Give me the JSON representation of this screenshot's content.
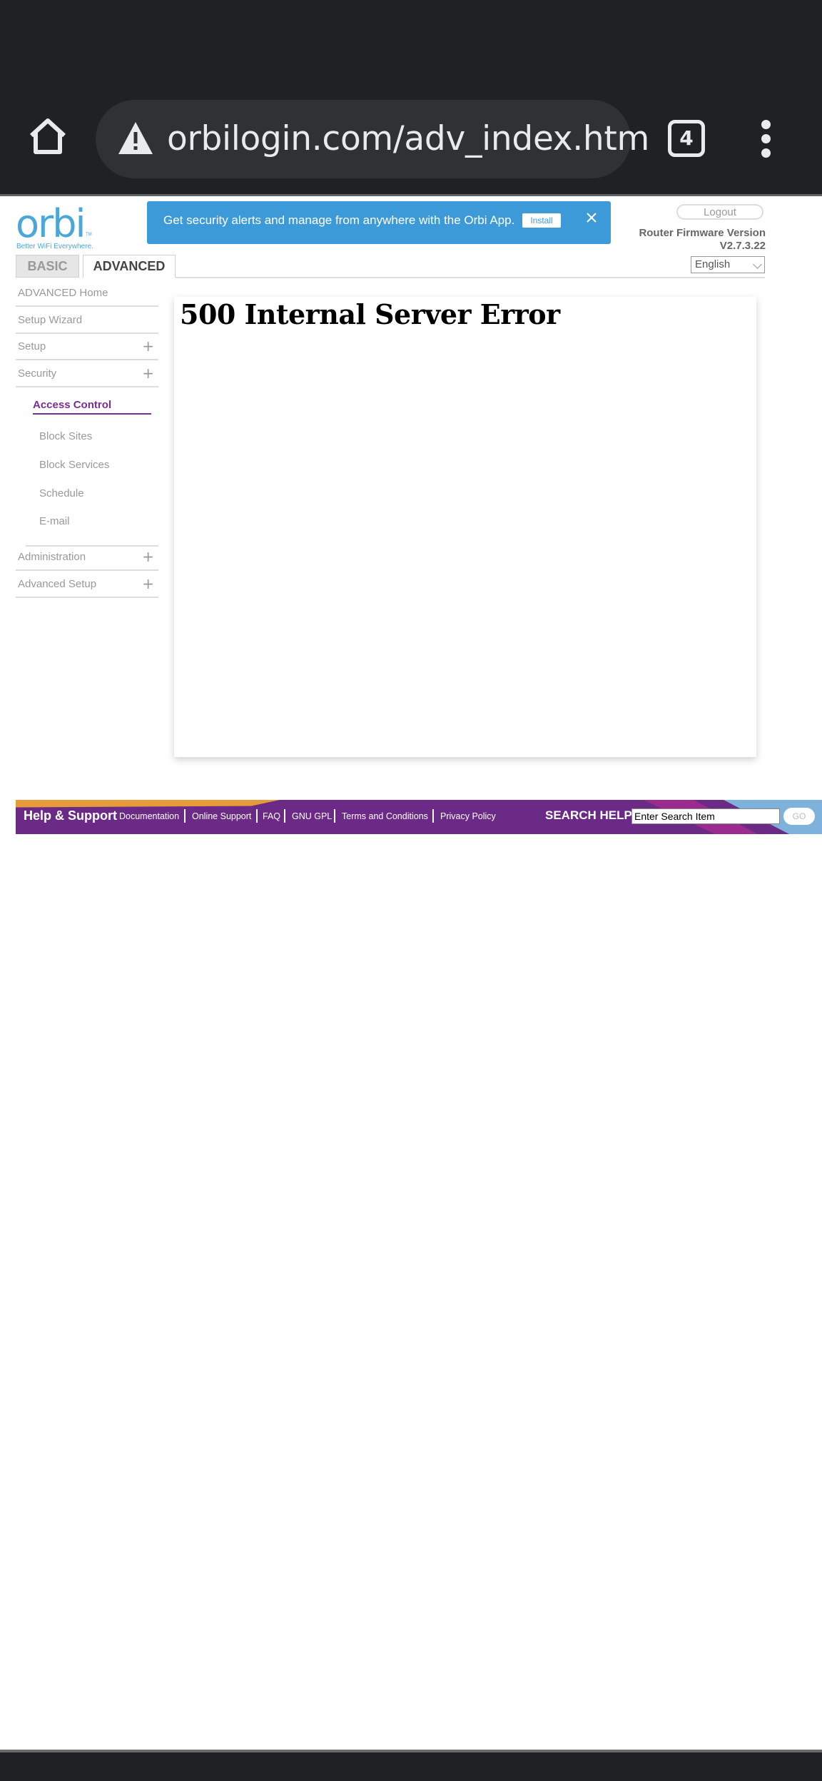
{
  "browser": {
    "url": "orbilogin.com/adv_index.htm",
    "tab_count": "4",
    "icons": [
      "home-icon",
      "warning-icon",
      "tabs-icon",
      "more-vert-icon"
    ]
  },
  "header": {
    "logo": "orbi",
    "logo_tm": "TM",
    "tagline": "Better WiFi Everywhere.",
    "banner_text": "Get security alerts and manage from anywhere with the Orbi App.",
    "install_label": "Install",
    "logout_label": "Logout",
    "firmware_label": "Router Firmware Version",
    "firmware_version": "V2.7.3.22",
    "language": "English"
  },
  "tabs": {
    "basic": "BASIC",
    "advanced": "ADVANCED"
  },
  "sidebar": {
    "items": [
      {
        "label": "ADVANCED Home"
      },
      {
        "label": "Setup Wizard"
      },
      {
        "label": "Setup"
      },
      {
        "label": "Security"
      },
      {
        "label": "Administration"
      },
      {
        "label": "Advanced Setup"
      }
    ],
    "security_sub": {
      "active": "Access Control",
      "items": [
        "Block Sites",
        "Block Services",
        "Schedule",
        "E-mail"
      ]
    }
  },
  "main": {
    "error_title": "500 Internal Server Error"
  },
  "footer": {
    "help_title": "Help & Support",
    "links": [
      "Documentation",
      "Online Support",
      "FAQ",
      "GNU GPL",
      "Terms and Conditions",
      "Privacy Policy"
    ],
    "search_label": "SEARCH HELP",
    "search_value": "Enter Search Item",
    "go_label": "GO"
  },
  "colors": {
    "accent_blue": "#3c9ad8",
    "accent_purple": "#7a2d91",
    "footer_purple": "#6b2a86",
    "footer_orange": "#e79a3a"
  }
}
